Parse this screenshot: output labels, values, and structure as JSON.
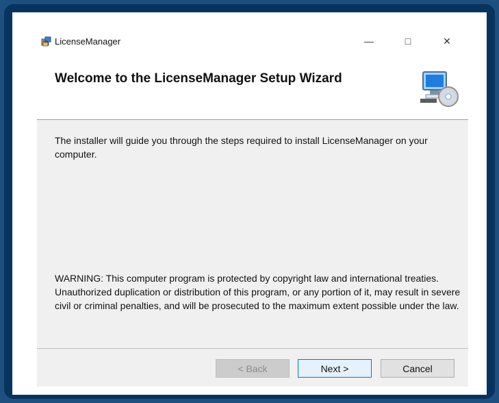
{
  "window": {
    "title": "LicenseManager",
    "minimize_glyph": "—",
    "maximize_glyph": "□",
    "close_glyph": "✕"
  },
  "header": {
    "title": "Welcome to the LicenseManager Setup Wizard"
  },
  "content": {
    "intro": "The installer will guide you through the steps required to install LicenseManager on your computer.",
    "warning": "WARNING: This computer program is protected by copyright law and international treaties. Unauthorized duplication or distribution of this program, or any portion of it, may result in severe civil or criminal penalties, and will be prosecuted to the maximum extent possible under the law."
  },
  "buttons": {
    "back": "< Back",
    "next": "Next >",
    "cancel": "Cancel"
  },
  "icons": {
    "app": "installer-package-icon",
    "setup": "computer-disc-icon"
  },
  "colors": {
    "frame": "#07335f",
    "window_bg": "#ffffff",
    "content_bg": "#f0f0f0",
    "next_border": "#0078d7"
  }
}
